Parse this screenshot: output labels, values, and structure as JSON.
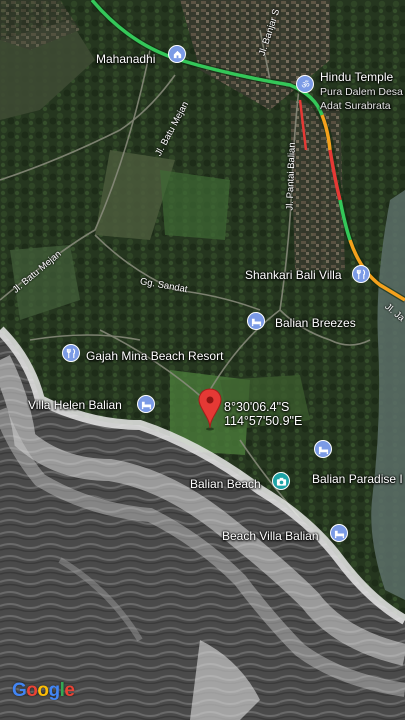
{
  "map": {
    "type": "satellite",
    "brand": "Google",
    "dropped_pin": {
      "latitude": "8°30'06.4\"S",
      "longitude": "114°57'50.9\"E",
      "color": "#e53935"
    },
    "places": [
      {
        "name": "Mahanadhi",
        "kind": "village",
        "icon": "village-icon"
      },
      {
        "name": "Hindu Temple",
        "subtitle": "Pura Dalem Desa",
        "subtitle2": "Adat Surabrata",
        "kind": "temple",
        "icon": "om-icon"
      },
      {
        "name": "Shankari Bali Villa",
        "kind": "hotel",
        "icon": "utensils-icon"
      },
      {
        "name": "Balian Breezes",
        "kind": "hotel",
        "icon": "bed-icon"
      },
      {
        "name": "Gajah Mina Beach Resort",
        "kind": "hotel",
        "icon": "utensils-icon"
      },
      {
        "name": "Villa Helen Balian",
        "kind": "hotel",
        "icon": "bed-icon"
      },
      {
        "name": "Balian Beach",
        "kind": "attraction",
        "icon": "camera-icon"
      },
      {
        "name": "Balian Paradise I",
        "kind": "hotel",
        "icon": "bed-icon"
      },
      {
        "name": "Beach Villa Balian",
        "kind": "hotel",
        "icon": "bed-icon"
      }
    ],
    "roads": [
      {
        "name": "Jl. Banjar S"
      },
      {
        "name": "Jl. Batu Mejan"
      },
      {
        "name": "Jl. Pantai Balian"
      },
      {
        "name": "Jl. Batu Mejan"
      },
      {
        "name": "Gg. Sandat"
      },
      {
        "name": "Jl. Ja"
      }
    ],
    "traffic_colors": {
      "free": "#34c759",
      "moderate": "#f4a11d",
      "heavy": "#e53935"
    },
    "logo_colors": [
      "#4285F4",
      "#EA4335",
      "#FBBC05",
      "#4285F4",
      "#34A853",
      "#EA4335"
    ]
  }
}
